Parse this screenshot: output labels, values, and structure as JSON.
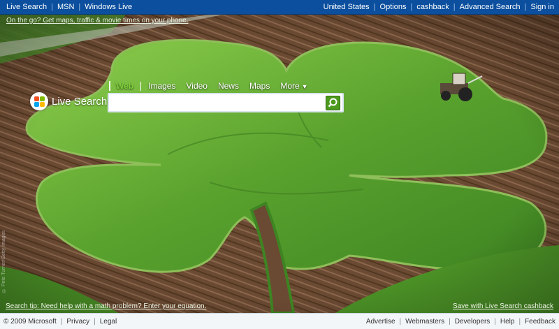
{
  "topbar": {
    "left_links": [
      "Live Search",
      "MSN",
      "Windows Live"
    ],
    "right_links": [
      "United States",
      "Options",
      "cashback",
      "Advanced Search",
      "Sign in"
    ]
  },
  "promo": {
    "top": "On the go? Get maps, traffic & movie times on your phone.",
    "bottom_left": "Search tip: Need help with a math problem? Enter your equation.",
    "bottom_right": "Save with Live Search cashback",
    "photo_credit": "© Pete Turner/Getty Images"
  },
  "logo": {
    "text": "Live Search",
    "icon": "windows-flag-orb-icon"
  },
  "search": {
    "tabs": [
      "Web",
      "Images",
      "Video",
      "News",
      "Maps",
      "More"
    ],
    "active_tab": "Web",
    "more_arrow": "▼",
    "query": "",
    "button_icon": "search-magnifier-icon"
  },
  "footer": {
    "copyright": "© 2009 Microsoft",
    "left_links": [
      "Privacy",
      "Legal"
    ],
    "right_links": [
      "Advertise",
      "Webmasters",
      "Developers",
      "Help",
      "Feedback"
    ]
  },
  "colors": {
    "topbar_bg": "#0b4f9e",
    "active_tab": "#7fd13b",
    "search_button": "#4c9a1e",
    "field_green": "#5fa832",
    "soil_brown": "#6b4a33"
  }
}
